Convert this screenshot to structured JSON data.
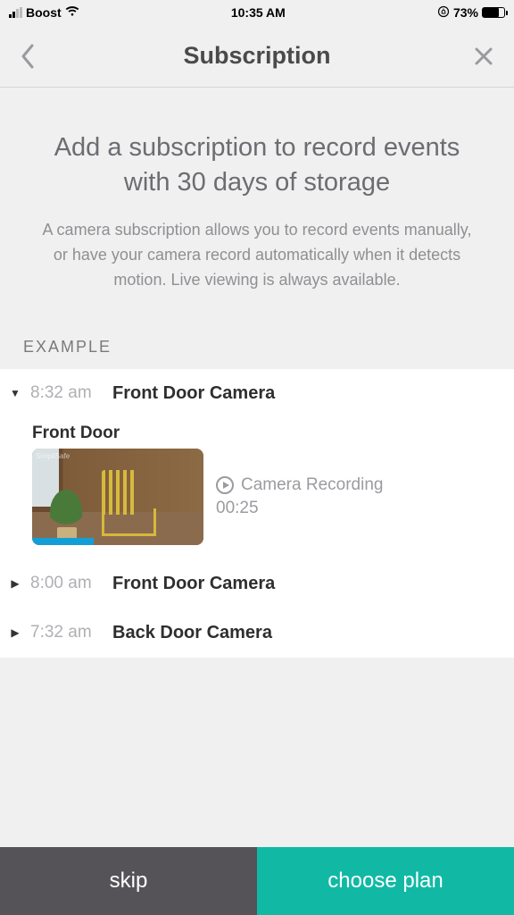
{
  "status": {
    "carrier": "Boost",
    "time": "10:35 AM",
    "battery_pct": "73%"
  },
  "nav": {
    "title": "Subscription"
  },
  "headline": "Add a subscription to record events with 30 days of storage",
  "subtext": "A camera subscription allows you to record events manually, or have your camera record automatically when it detects motion. Live viewing is always available.",
  "example_label": "EXAMPLE",
  "events": [
    {
      "time": "8:32 am",
      "name": "Front Door Camera",
      "expanded": true
    },
    {
      "time": "8:00 am",
      "name": "Front Door Camera",
      "expanded": false
    },
    {
      "time": "7:32 am",
      "name": "Back Door Camera",
      "expanded": false
    }
  ],
  "recording": {
    "title": "Front Door",
    "label": "Camera Recording",
    "duration": "00:25"
  },
  "footer": {
    "skip": "skip",
    "choose": "choose plan"
  }
}
